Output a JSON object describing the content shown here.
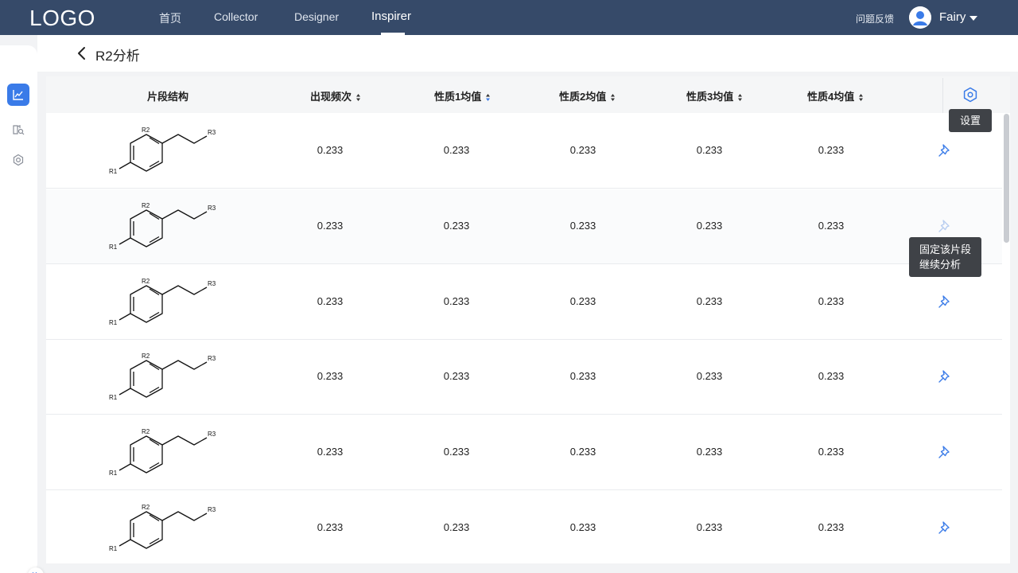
{
  "nav": {
    "logo": "LOGO",
    "items": [
      {
        "label": "首页"
      },
      {
        "label": "Collector"
      },
      {
        "label": "Designer"
      },
      {
        "label": "Inspirer"
      }
    ],
    "active_item": "Inspirer",
    "feedback": "问题反馈",
    "user": "Fairy"
  },
  "page": {
    "title": "R2分析"
  },
  "table": {
    "columns": [
      {
        "label": "片段结构"
      },
      {
        "label": "出现频次"
      },
      {
        "label": "性质1均值"
      },
      {
        "label": "性质2均值"
      },
      {
        "label": "性质3均值"
      },
      {
        "label": "性质4均值"
      }
    ],
    "rows": [
      {
        "structure": {
          "r1": "R1",
          "r2": "R2",
          "r3": "R3"
        },
        "values": [
          "0.233",
          "0.233",
          "0.233",
          "0.233",
          "0.233"
        ]
      },
      {
        "structure": {
          "r1": "R1",
          "r2": "R2",
          "r3": "R3"
        },
        "values": [
          "0.233",
          "0.233",
          "0.233",
          "0.233",
          "0.233"
        ]
      },
      {
        "structure": {
          "r1": "R1",
          "r2": "R2",
          "r3": "R3"
        },
        "values": [
          "0.233",
          "0.233",
          "0.233",
          "0.233",
          "0.233"
        ]
      },
      {
        "structure": {
          "r1": "R1",
          "r2": "R2",
          "r3": "R3"
        },
        "values": [
          "0.233",
          "0.233",
          "0.233",
          "0.233",
          "0.233"
        ]
      },
      {
        "structure": {
          "r1": "R1",
          "r2": "R2",
          "r3": "R3"
        },
        "values": [
          "0.233",
          "0.233",
          "0.233",
          "0.233",
          "0.233"
        ]
      },
      {
        "structure": {
          "r1": "R1",
          "r2": "R2",
          "r3": "R3"
        },
        "values": [
          "0.233",
          "0.233",
          "0.233",
          "0.233",
          "0.233"
        ]
      }
    ]
  },
  "tooltips": {
    "settings": "设置",
    "pin_line1": "固定该片段",
    "pin_line2": "继续分析"
  },
  "icons": {
    "sidebar": [
      "chart-icon",
      "book-search-icon",
      "gear-nodes-icon"
    ],
    "settings": "hexagon-gear-icon",
    "pin": "pushpin-icon",
    "back": "chevron-left-icon",
    "expand": "double-chevron-right-icon"
  },
  "colors": {
    "topbar": "#364a69",
    "accent": "#3a7be8",
    "pin": "#3a7be8",
    "pin_faded": "#b8cdf0",
    "tooltip": "#3f4247"
  }
}
